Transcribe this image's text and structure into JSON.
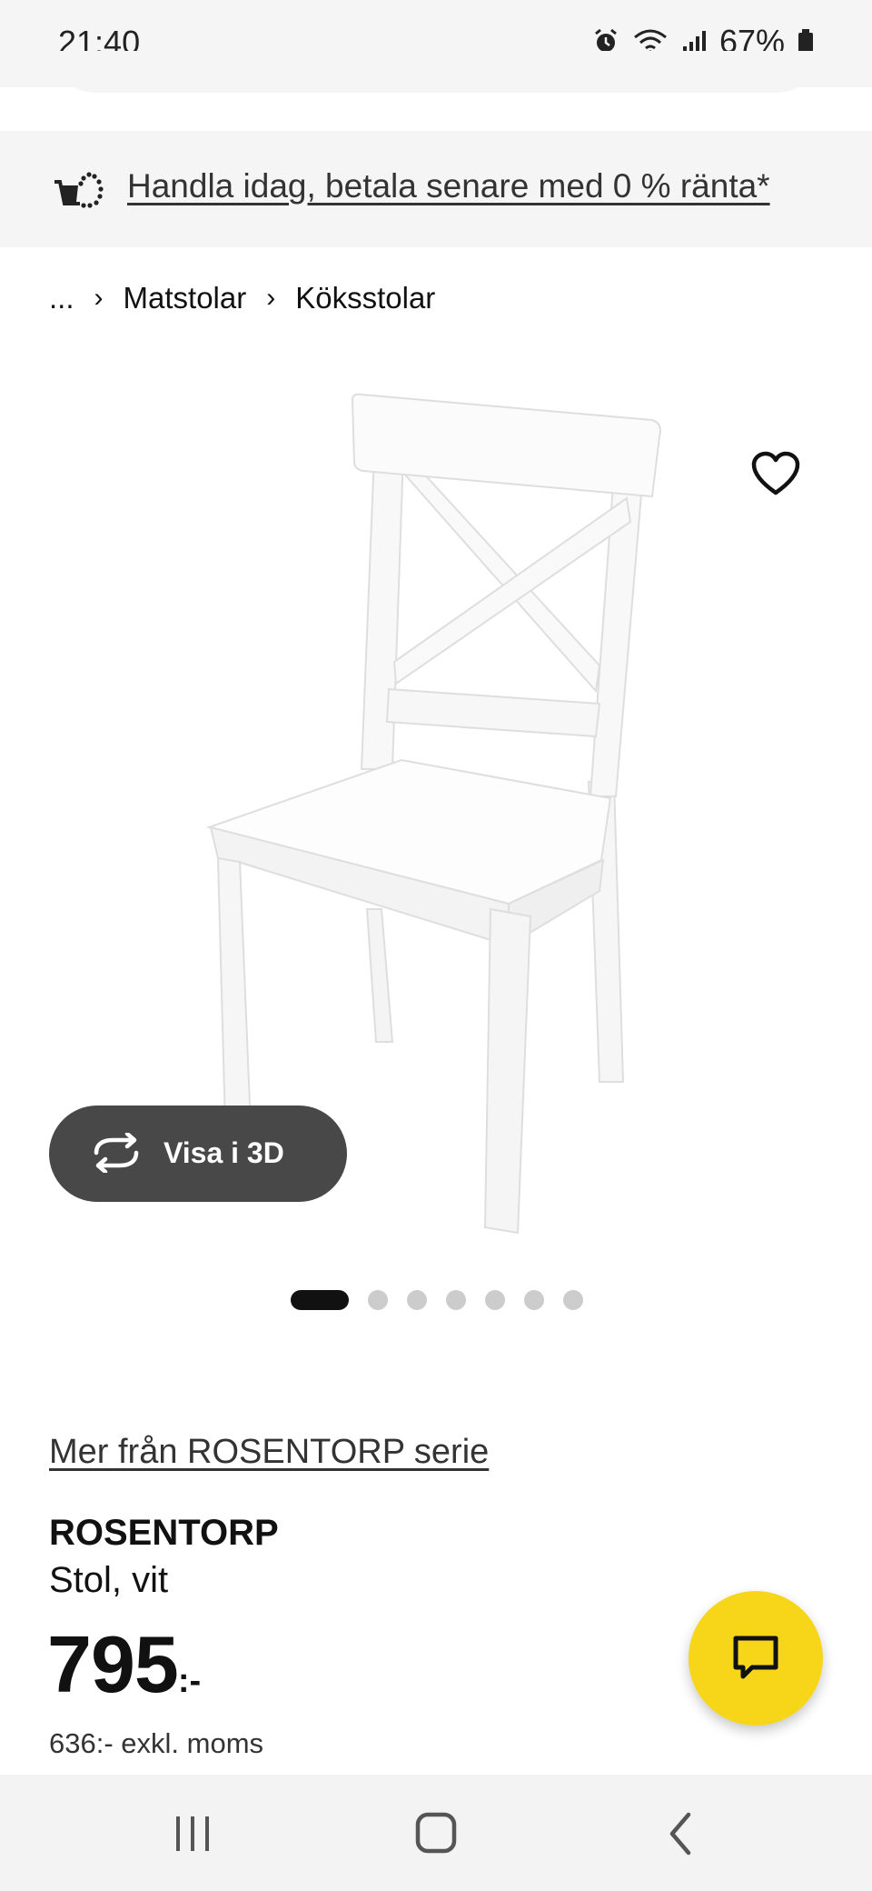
{
  "status_bar": {
    "time": "21:40",
    "battery": "67%",
    "icons": [
      "alarm-icon",
      "wifi-icon",
      "signal-icon",
      "battery-icon"
    ]
  },
  "promo": {
    "icon": "cart-icon",
    "text": "Handla idag, betala senare med 0 % ränta*"
  },
  "breadcrumb": {
    "ellipsis": "...",
    "items": [
      "Matstolar",
      "Köksstolar"
    ]
  },
  "gallery": {
    "favorite_icon": "heart-icon",
    "view3d_label": "Visa i 3D",
    "view3d_icon": "rotate-icon",
    "image_count": 7,
    "active_index": 0
  },
  "product": {
    "series_link": "Mer från ROSENTORP serie",
    "name": "ROSENTORP",
    "description": "Stol, vit",
    "price": "795",
    "price_suffix": ":-",
    "price_excl_vat": "636:- exkl. moms"
  },
  "chat_button": {
    "icon": "chat-icon"
  },
  "colors": {
    "accent_yellow": "#f7d619",
    "dark_button": "#484848",
    "gray_bg": "#f5f5f5"
  },
  "nav_bar": {
    "icons": [
      "recent-apps-icon",
      "home-icon",
      "back-icon"
    ]
  }
}
